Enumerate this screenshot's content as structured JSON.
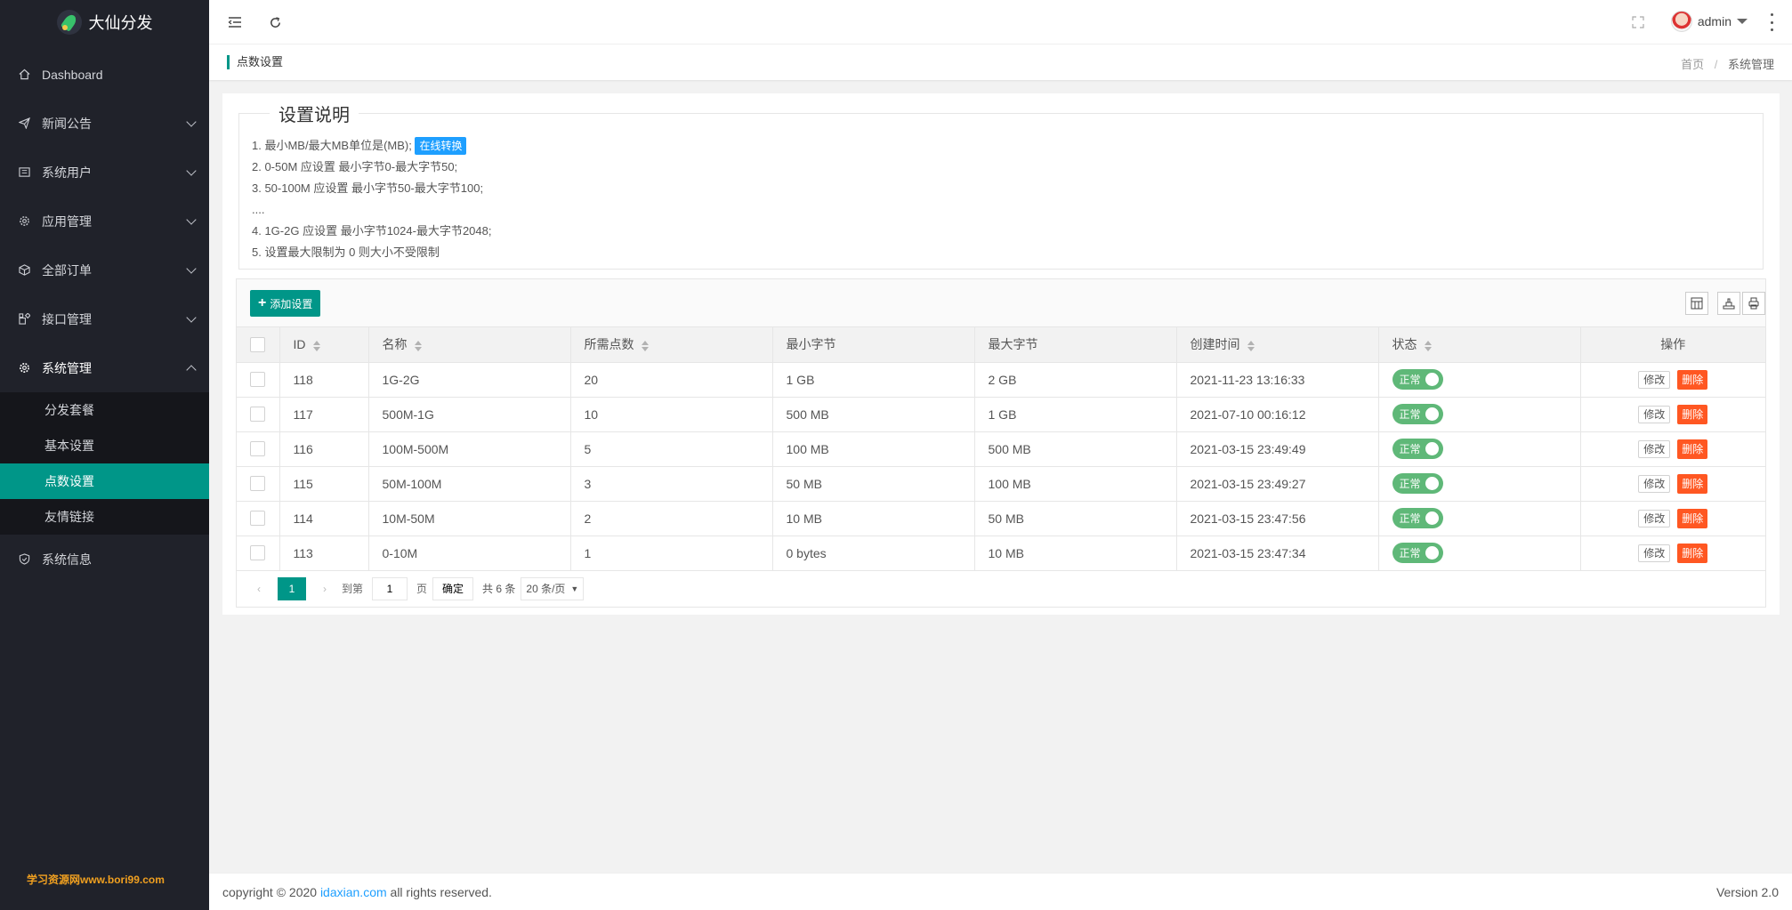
{
  "app": {
    "name": "大仙分发"
  },
  "sidebar": {
    "items": [
      {
        "label": "Dashboard",
        "icon": "home-icon",
        "expandable": false
      },
      {
        "label": "新闻公告",
        "icon": "send-icon",
        "expandable": true
      },
      {
        "label": "系统用户",
        "icon": "users-icon",
        "expandable": true
      },
      {
        "label": "应用管理",
        "icon": "gear-icon",
        "expandable": true
      },
      {
        "label": "全部订单",
        "icon": "box-icon",
        "expandable": true
      },
      {
        "label": "接口管理",
        "icon": "api-icon",
        "expandable": true
      },
      {
        "label": "系统管理",
        "icon": "settings-icon",
        "expandable": true,
        "open": true
      }
    ],
    "sub_items": [
      "分发套餐",
      "基本设置",
      "点数设置",
      "友情链接"
    ],
    "active_sub": "点数设置",
    "after": {
      "label": "系统信息",
      "icon": "shield-icon"
    },
    "watermark": "学习资源网www.bori99.com"
  },
  "header": {
    "user": "admin"
  },
  "breadcrumb": {
    "title": "点数设置",
    "home": "首页",
    "current": "系统管理"
  },
  "note": {
    "legend": "设置说明",
    "line1": "1. 最小MB/最大MB单位是(MB);",
    "line1_link": "在线转换",
    "line2": "2. 0-50M 应设置 最小字节0-最大字节50;",
    "line3": "3. 50-100M 应设置 最小字节50-最大字节100;",
    "line_dots": "....",
    "line4": "4. 1G-2G 应设置 最小字节1024-最大字节2048;",
    "line5": "5. 设置最大限制为 0 则大小不受限制"
  },
  "toolbar": {
    "add_label": "添加设置"
  },
  "table": {
    "columns": [
      "ID",
      "名称",
      "所需点数",
      "最小字节",
      "最大字节",
      "创建时间",
      "状态",
      "操作"
    ],
    "rows": [
      {
        "id": "118",
        "name": "1G-2G",
        "points": "20",
        "min": "1 GB",
        "max": "2 GB",
        "created": "2021-11-23 13:16:33",
        "status": "正常"
      },
      {
        "id": "117",
        "name": "500M-1G",
        "points": "10",
        "min": "500 MB",
        "max": "1 GB",
        "created": "2021-07-10 00:16:12",
        "status": "正常"
      },
      {
        "id": "116",
        "name": "100M-500M",
        "points": "5",
        "min": "100 MB",
        "max": "500 MB",
        "created": "2021-03-15 23:49:49",
        "status": "正常"
      },
      {
        "id": "115",
        "name": "50M-100M",
        "points": "3",
        "min": "50 MB",
        "max": "100 MB",
        "created": "2021-03-15 23:49:27",
        "status": "正常"
      },
      {
        "id": "114",
        "name": "10M-50M",
        "points": "2",
        "min": "10 MB",
        "max": "50 MB",
        "created": "2021-03-15 23:47:56",
        "status": "正常"
      },
      {
        "id": "113",
        "name": "0-10M",
        "points": "1",
        "min": "0 bytes",
        "max": "10 MB",
        "created": "2021-03-15 23:47:34",
        "status": "正常"
      }
    ],
    "edit_label": "修改",
    "delete_label": "删除"
  },
  "pager": {
    "current": "1",
    "goto": "到第",
    "goto_value": "1",
    "page_unit": "页",
    "confirm": "确定",
    "total": "共 6 条",
    "page_size": "20 条/页"
  },
  "footer": {
    "copyright_prefix": "copyright © 2020",
    "link": "idaxian.com",
    "copyright_suffix": "all rights reserved.",
    "version": "Version 2.0"
  },
  "colors": {
    "accent": "#009688",
    "danger": "#ff5722",
    "info": "#1e9fff",
    "switch_on": "#5fb878",
    "sidebar_bg": "#20222a"
  }
}
